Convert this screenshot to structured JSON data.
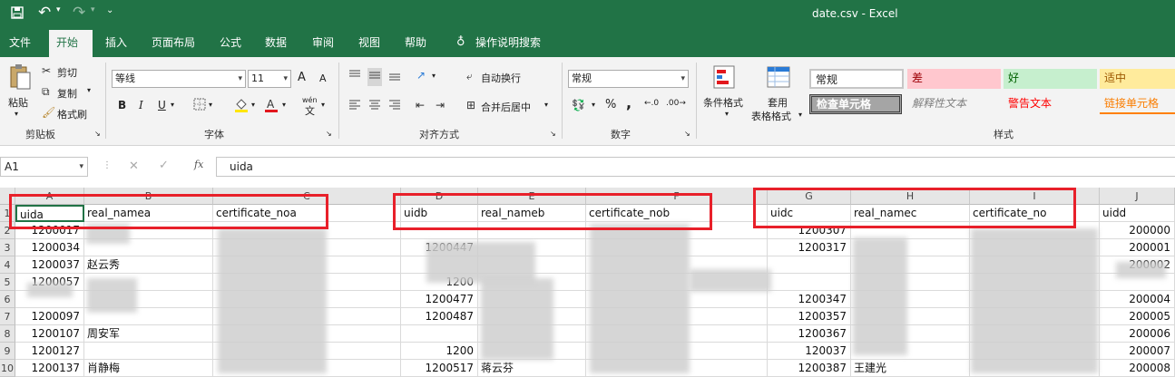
{
  "window": {
    "title": "date.csv  -  Excel"
  },
  "quick_access": {
    "save_icon": "save-icon",
    "undo_icon": "undo-icon",
    "redo_icon": "redo-icon"
  },
  "menu_tabs": [
    "文件",
    "开始",
    "插入",
    "页面布局",
    "公式",
    "数据",
    "审阅",
    "视图",
    "帮助",
    "操作说明搜索"
  ],
  "active_tab": "开始",
  "ribbon": {
    "clipboard": {
      "paste": "粘贴",
      "cut": "剪切",
      "copy": "复制",
      "format_painter": "格式刷",
      "label": "剪贴板"
    },
    "font": {
      "font_name": "等线",
      "font_size": "11",
      "bold": "B",
      "italic": "I",
      "underline": "U",
      "grow": "A",
      "shrink": "A",
      "wen": "wén",
      "label": "字体"
    },
    "alignment": {
      "wrap_text": "自动换行",
      "merge_center": "合并后居中",
      "label": "对齐方式"
    },
    "number": {
      "format": "常规",
      "percent": "%",
      "comma": ",",
      "label": "数字"
    },
    "styles": {
      "conditional": "条件格式",
      "table_format_1": "套用",
      "table_format_2": "表格格式",
      "normal": "常规",
      "bad": "差",
      "good": "好",
      "neutral": "适中",
      "check_cell": "检查单元格",
      "explanatory": "解释性文本",
      "warning": "警告文本",
      "linked_cell": "链接单元格",
      "label": "样式"
    }
  },
  "formula_bar": {
    "name_box": "A1",
    "fx": "fx",
    "content": "uida"
  },
  "grid": {
    "columns": [
      "A",
      "B",
      "C",
      "D",
      "E",
      "F",
      "G",
      "H",
      "I",
      "J"
    ],
    "rows": [
      "1",
      "2",
      "3",
      "4",
      "5",
      "6",
      "7",
      "8",
      "9",
      "10"
    ],
    "header_row": [
      "uida",
      "real_namea",
      "certificate_noa",
      "uidb",
      "real_nameb",
      "certificate_nob",
      "uidc",
      "real_namec",
      "certificate_no",
      "uidd"
    ],
    "col_a": [
      "1200017",
      "1200034",
      "1200037",
      "1200057",
      "",
      "1200097",
      "1200107",
      "1200127",
      "1200137"
    ],
    "col_b": [
      "",
      "",
      "赵云秀",
      "",
      "",
      "",
      "周安军",
      "",
      "肖静梅"
    ],
    "col_d": [
      "",
      "1200447",
      "",
      "1200",
      "1200477",
      "1200487",
      "",
      "1200",
      "1200517"
    ],
    "col_e": [
      "",
      "",
      "",
      "",
      "",
      "",
      "",
      "",
      "蒋云芬"
    ],
    "col_g": [
      "1200307",
      "1200317",
      "",
      "",
      "1200347",
      "1200357",
      "1200367",
      "120037",
      "1200387"
    ],
    "col_h": [
      "",
      "",
      "",
      "",
      "",
      "",
      "",
      "",
      "王建光"
    ],
    "col_j": [
      "200000",
      "200001",
      "200002",
      "",
      "200004",
      "200005",
      "200006",
      "200007",
      "200008"
    ]
  }
}
